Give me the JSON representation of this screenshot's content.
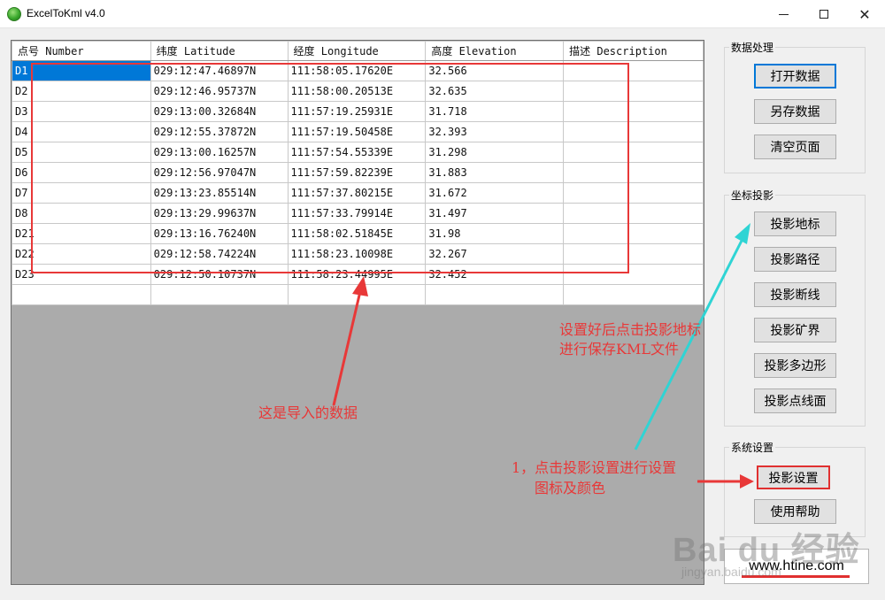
{
  "window": {
    "title": "ExcelToKml v4.0",
    "minimize_glyph": "",
    "close_glyph": "✕"
  },
  "grid": {
    "columns": [
      "点号 Number",
      "纬度 Latitude",
      "经度 Longitude",
      "高度 Elevation",
      "描述 Description"
    ],
    "rows": [
      [
        "D1",
        "029:12:47.46897N",
        "111:58:05.17620E",
        "32.566",
        ""
      ],
      [
        "D2",
        "029:12:46.95737N",
        "111:58:00.20513E",
        "32.635",
        ""
      ],
      [
        "D3",
        "029:13:00.32684N",
        "111:57:19.25931E",
        "31.718",
        ""
      ],
      [
        "D4",
        "029:12:55.37872N",
        "111:57:19.50458E",
        "32.393",
        ""
      ],
      [
        "D5",
        "029:13:00.16257N",
        "111:57:54.55339E",
        "31.298",
        ""
      ],
      [
        "D6",
        "029:12:56.97047N",
        "111:57:59.82239E",
        "31.883",
        ""
      ],
      [
        "D7",
        "029:13:23.85514N",
        "111:57:37.80215E",
        "31.672",
        ""
      ],
      [
        "D8",
        "029:13:29.99637N",
        "111:57:33.79914E",
        "31.497",
        ""
      ],
      [
        "D21",
        "029:13:16.76240N",
        "111:58:02.51845E",
        "31.98",
        ""
      ],
      [
        "D22",
        "029:12:58.74224N",
        "111:58:23.10098E",
        "32.267",
        ""
      ],
      [
        "D23",
        "029:12:50.10737N",
        "111:58:23.44995E",
        "32.452",
        ""
      ],
      [
        "",
        "",
        "",
        "",
        ""
      ]
    ]
  },
  "panel": {
    "data_group": {
      "title": "数据处理",
      "buttons": [
        "打开数据",
        "另存数据",
        "清空页面"
      ]
    },
    "projection_group": {
      "title": "坐标投影",
      "buttons": [
        "投影地标",
        "投影路径",
        "投影断线",
        "投影矿界",
        "投影多边形",
        "投影点线面"
      ]
    },
    "system_group": {
      "title": "系统设置",
      "buttons": [
        "投影设置",
        "使用帮助"
      ]
    },
    "website": "www.htine.com"
  },
  "annotations": {
    "imported_data": "这是导入的数据",
    "save_kml_line1": "设置好后点击投影地标",
    "save_kml_line2": "进行保存KML文件",
    "step1_line1": "1，点击投影设置进行设置",
    "step1_line2": "图标及颜色",
    "color": "#e83838",
    "arrow_cyan": "#2fd4d4"
  },
  "watermark": {
    "brand": "Bai du 经验",
    "sub": "jingyan.baidu.com"
  }
}
